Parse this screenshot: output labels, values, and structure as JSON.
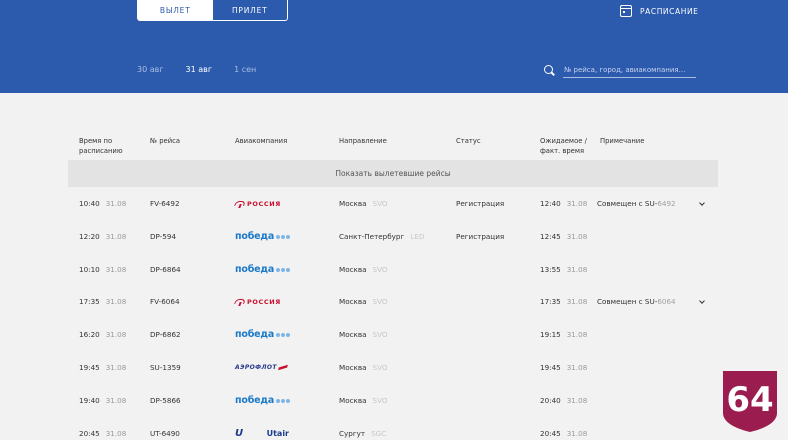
{
  "header": {
    "toggle": {
      "departure": "ВЫЛЕТ",
      "arrival": "ПРИЛЕТ"
    },
    "schedule_label": "РАСПИСАНИЕ",
    "dates": [
      "30 авг",
      "31 авг",
      "1 сен"
    ],
    "active_date": "31 авг",
    "search": {
      "placeholder": "№ рейса, город, авиакомпания...",
      "value": ""
    }
  },
  "columns": {
    "sched_time": "Время по расписанию",
    "flight": "№ рейса",
    "airline": "Авиакомпания",
    "direction": "Направление",
    "status": "Статус",
    "expected": "Ожидаемое / факт. время",
    "note": "Примечание"
  },
  "show_departed": "Показать вылетевшие рейсы",
  "flights": [
    {
      "time": "10:40",
      "date": "31.08",
      "flight": "FV-6492",
      "airline": "РОССИЯ",
      "airline_logo": "rossiya",
      "city": "Москва",
      "code": "SVO",
      "status": "Регистрация",
      "exp_time": "12:40",
      "exp_date": "31.08",
      "note": "Совмещен с SU-",
      "note_code": "6492",
      "expand": true
    },
    {
      "time": "12:20",
      "date": "31.08",
      "flight": "DP-594",
      "airline": "победа",
      "airline_logo": "pobeda",
      "city": "Санкт-Петербург",
      "code": "LED",
      "status": "Регистрация",
      "exp_time": "12:45",
      "exp_date": "31.08",
      "note": "",
      "note_code": "",
      "expand": false
    },
    {
      "time": "10:10",
      "date": "31.08",
      "flight": "DP-6864",
      "airline": "победа",
      "airline_logo": "pobeda",
      "city": "Москва",
      "code": "SVO",
      "status": "",
      "exp_time": "13:55",
      "exp_date": "31.08",
      "note": "",
      "note_code": "",
      "expand": false
    },
    {
      "time": "17:35",
      "date": "31.08",
      "flight": "FV-6064",
      "airline": "РОССИЯ",
      "airline_logo": "rossiya",
      "city": "Москва",
      "code": "SVO",
      "status": "",
      "exp_time": "17:35",
      "exp_date": "31.08",
      "note": "Совмещен с SU-",
      "note_code": "6064",
      "expand": true
    },
    {
      "time": "16:20",
      "date": "31.08",
      "flight": "DP-6862",
      "airline": "победа",
      "airline_logo": "pobeda",
      "city": "Москва",
      "code": "SVO",
      "status": "",
      "exp_time": "19:15",
      "exp_date": "31.08",
      "note": "",
      "note_code": "",
      "expand": false
    },
    {
      "time": "19:45",
      "date": "31.08",
      "flight": "SU-1359",
      "airline": "АЭРОФЛОТ",
      "airline_logo": "aeroflot",
      "city": "Москва",
      "code": "SVO",
      "status": "",
      "exp_time": "19:45",
      "exp_date": "31.08",
      "note": "",
      "note_code": "",
      "expand": false
    },
    {
      "time": "19:40",
      "date": "31.08",
      "flight": "DP-5866",
      "airline": "победа",
      "airline_logo": "pobeda",
      "city": "Москва",
      "code": "SVO",
      "status": "",
      "exp_time": "20:40",
      "exp_date": "31.08",
      "note": "",
      "note_code": "",
      "expand": false
    },
    {
      "time": "20:45",
      "date": "31.08",
      "flight": "UT-6490",
      "airline": "Utair",
      "airline_logo": "utair",
      "city": "Сургут",
      "code": "SGC",
      "status": "",
      "exp_time": "20:45",
      "exp_date": "31.08",
      "note": "",
      "note_code": "",
      "expand": false
    }
  ],
  "badge": {
    "text": "64",
    "color": "#9b1d4f"
  },
  "colors": {
    "header": "#2c5aad",
    "rossiya": "#c8102e",
    "pobeda": "#1c7ac9"
  }
}
